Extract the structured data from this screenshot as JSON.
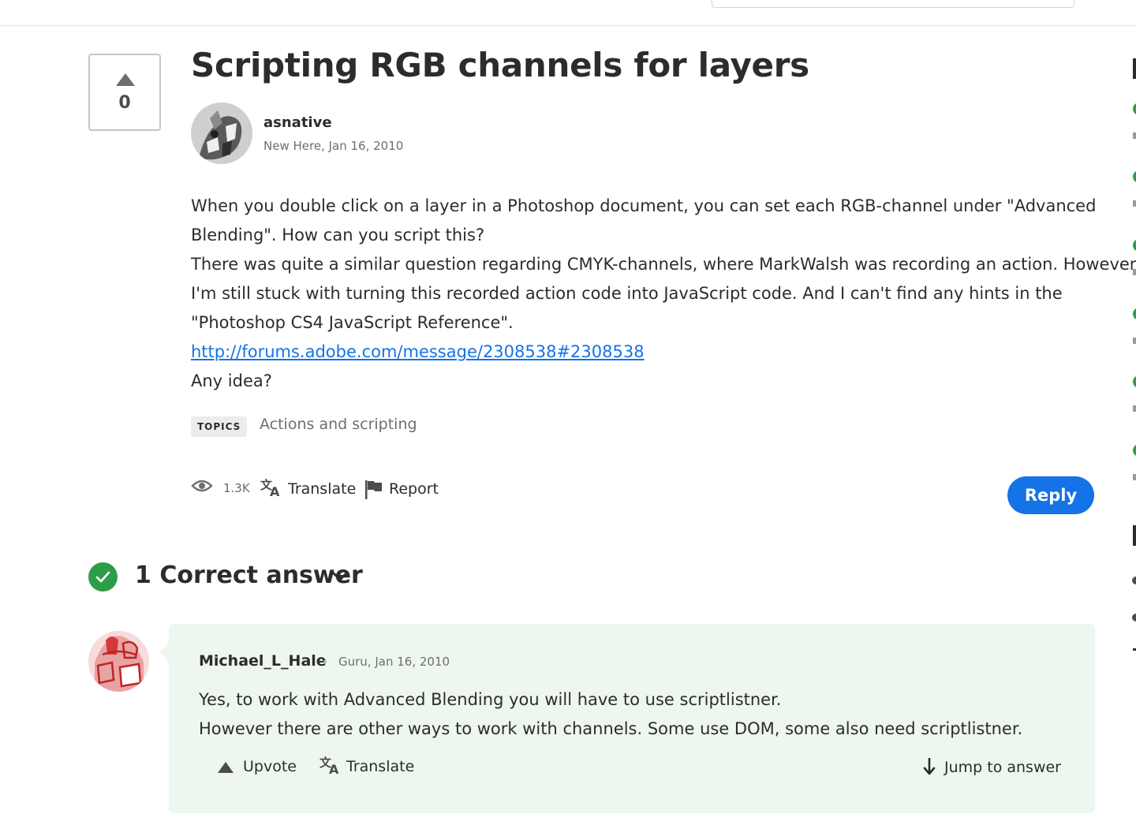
{
  "post": {
    "vote_count": "0",
    "title": "Scripting RGB channels for layers",
    "author": {
      "name": "asnative",
      "meta": "New Here, Jan 16, 2010"
    },
    "body_lines": [
      "When you double click on a layer in a Photoshop document, you can set each RGB-channel under \"Advanced",
      "Blending\". How can you script this?",
      "There was quite a similar question regarding CMYK-channels, where MarkWalsh was recording an action. However,",
      "I'm still stuck with turning this recorded action code into JavaScript code. And I can't find any hints in the",
      "\"Photoshop CS4 JavaScript Reference\"."
    ],
    "link": "http://forums.adobe.com/message/2308538#2308538",
    "closing": "Any idea?",
    "topics_label": "TOPICS",
    "topic": "Actions and scripting",
    "views": "1.3K",
    "translate_label": "Translate",
    "report_label": "Report",
    "reply_label": "Reply"
  },
  "correct_answer": {
    "heading": "1 Correct answer",
    "author": "Michael_L_Hale",
    "meta": "Guru, Jan 16, 2010",
    "body_lines": [
      "Yes, to work with Advanced Blending you will have to use scriptlistner.",
      "However there are other ways to work with channels. Some use DOM, some also need scriptlistner."
    ],
    "upvote_label": "Upvote",
    "translate_label": "Translate",
    "jump_label": "Jump to answer"
  },
  "colors": {
    "accent": "#1473e6",
    "success": "#2d9d4a",
    "answer_bg": "#eef7ef"
  },
  "icons": [
    "triangle-up-icon",
    "eye-icon",
    "translate-icon",
    "flag-icon",
    "check-circle-icon",
    "chevron-down-icon",
    "arrow-down-icon"
  ]
}
